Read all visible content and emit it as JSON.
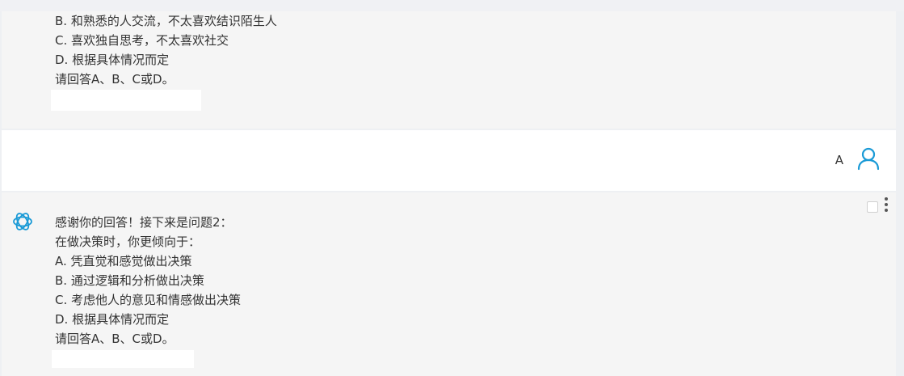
{
  "conversation": {
    "ai_message_1": {
      "lines": [
        "B. 和熟悉的人交流，不太喜欢结识陌生人",
        "C. 喜欢独自思考，不太喜欢社交",
        "D. 根据具体情况而定",
        "请回答A、B、C或D。"
      ]
    },
    "user_message": {
      "text": "A",
      "avatar_icon": "user-outline-icon"
    },
    "ai_message_2": {
      "logo_icon": "openai-logo-icon",
      "lines": [
        "感谢你的回答！接下来是问题2：",
        "在做决策时，你更倾向于：",
        "A. 凭直觉和感觉做出决策",
        "B. 通过逻辑和分析做出决策",
        "C. 考虑他人的意见和情感做出决策",
        "D. 根据具体情况而定",
        "请回答A、B、C或D。"
      ],
      "menu_icon": "more-vertical-icon"
    }
  },
  "colors": {
    "accent": "#1a9ad6",
    "ai_bg": "#f5f5f5",
    "user_bg": "#ffffff",
    "text": "#333333"
  }
}
